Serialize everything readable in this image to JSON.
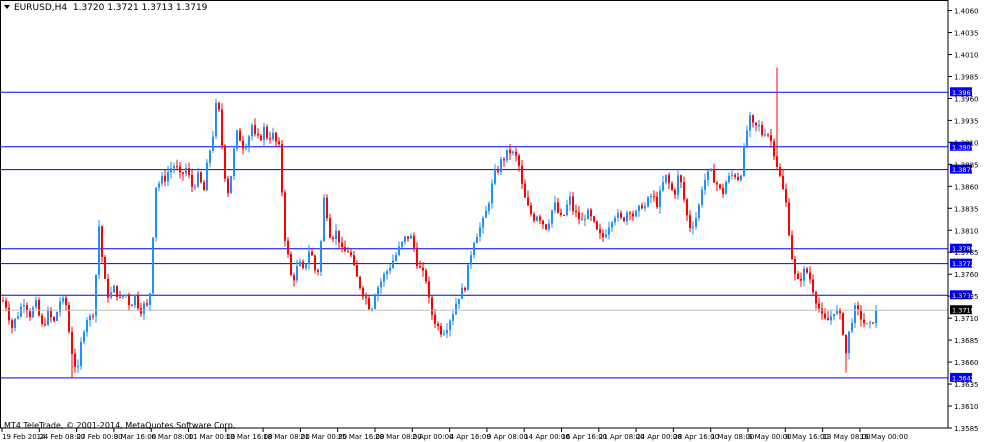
{
  "window": {
    "symbol_title": "EURUSD,H4",
    "ohlc": "1.3720 1.3721 1.3713 1.3719",
    "copyright": "MT4 TeleTrade, © 2001-2014, MetaQuotes Software Corp."
  },
  "colors": {
    "background": "#ffffff",
    "bull_candle": "#1e90ff",
    "bear_candle": "#ff0000",
    "level_line": "#0000ff",
    "level_label_bg": "#0000ff",
    "current_price_bg": "#000000",
    "axis_text": "#000000"
  },
  "chart_data": {
    "type": "candlestick",
    "symbol": "EURUSD",
    "timeframe": "H4",
    "y_axis": {
      "ticks": [
        "1.4060",
        "1.4035",
        "1.4010",
        "1.3985",
        "1.3960",
        "1.3935",
        "1.3910",
        "1.3885",
        "1.3860",
        "1.3835",
        "1.3810",
        "1.3785",
        "1.3760",
        "1.3735",
        "1.3710",
        "1.3685",
        "1.3660",
        "1.3635",
        "1.3610",
        "1.3585"
      ],
      "range": [
        1.3585,
        1.4072
      ]
    },
    "x_axis": {
      "ticks": [
        "19 Feb 2014",
        "24 Feb 08:00",
        "27 Feb 00:00",
        "3 Mar 16:00",
        "6 Mar 08:00",
        "11 Mar 00:00",
        "13 Mar 16:00",
        "18 Mar 08:00",
        "21 Mar 00:00",
        "25 Mar 16:00",
        "28 Mar 08:00",
        "2 Apr 00:00",
        "4 Apr 16:00",
        "9 Apr 08:00",
        "14 Apr 00:00",
        "16 Apr 16:00",
        "21 Apr 08:00",
        "24 Apr 00:00",
        "28 Apr 16:00",
        "1 May 08:00",
        "6 May 00:00",
        "8 May 16:00",
        "13 May 08:00",
        "16 May 00:00"
      ]
    },
    "horizontal_levels": [
      "1.3967",
      "1.3905",
      "1.3879",
      "1.3789",
      "1.3772",
      "1.3736",
      "1.3642"
    ],
    "current_price": "1.3719",
    "price_path": [
      [
        0,
        1.3735
      ],
      [
        6,
        1.3725
      ],
      [
        12,
        1.37
      ],
      [
        18,
        1.3715
      ],
      [
        24,
        1.373
      ],
      [
        30,
        1.3715
      ],
      [
        36,
        1.3725
      ],
      [
        42,
        1.37
      ],
      [
        48,
        1.3715
      ],
      [
        54,
        1.3705
      ],
      [
        60,
        1.373
      ],
      [
        66,
        1.3725
      ],
      [
        70,
        1.3685
      ],
      [
        74,
        1.366
      ],
      [
        78,
        1.365
      ],
      [
        81,
        1.368
      ],
      [
        84,
        1.37
      ],
      [
        88,
        1.3715
      ],
      [
        92,
        1.3705
      ],
      [
        96,
        1.376
      ],
      [
        99,
        1.3815
      ],
      [
        102,
        1.378
      ],
      [
        106,
        1.374
      ],
      [
        110,
        1.3735
      ],
      [
        115,
        1.3745
      ],
      [
        120,
        1.373
      ],
      [
        125,
        1.374
      ],
      [
        130,
        1.3725
      ],
      [
        135,
        1.3735
      ],
      [
        140,
        1.372
      ],
      [
        145,
        1.3725
      ],
      [
        149,
        1.372
      ],
      [
        152,
        1.378
      ],
      [
        155,
        1.386
      ],
      [
        160,
        1.3865
      ],
      [
        165,
        1.387
      ],
      [
        170,
        1.388
      ],
      [
        175,
        1.3885
      ],
      [
        180,
        1.387
      ],
      [
        186,
        1.388
      ],
      [
        192,
        1.386
      ],
      [
        198,
        1.387
      ],
      [
        204,
        1.3855
      ],
      [
        208,
        1.389
      ],
      [
        213,
        1.392
      ],
      [
        217,
        1.396
      ],
      [
        220,
        1.3935
      ],
      [
        224,
        1.388
      ],
      [
        228,
        1.3855
      ],
      [
        232,
        1.388
      ],
      [
        236,
        1.392
      ],
      [
        240,
        1.3915
      ],
      [
        244,
        1.3905
      ],
      [
        248,
        1.3915
      ],
      [
        252,
        1.393
      ],
      [
        256,
        1.391
      ],
      [
        260,
        1.3915
      ],
      [
        264,
        1.3925
      ],
      [
        268,
        1.3915
      ],
      [
        272,
        1.392
      ],
      [
        276,
        1.391
      ],
      [
        280,
        1.39
      ],
      [
        284,
        1.381
      ],
      [
        288,
        1.378
      ],
      [
        292,
        1.375
      ],
      [
        296,
        1.3765
      ],
      [
        300,
        1.377
      ],
      [
        304,
        1.376
      ],
      [
        308,
        1.379
      ],
      [
        312,
        1.378
      ],
      [
        316,
        1.376
      ],
      [
        320,
        1.377
      ],
      [
        323,
        1.385
      ],
      [
        327,
        1.383
      ],
      [
        331,
        1.38
      ],
      [
        335,
        1.381
      ],
      [
        339,
        1.38
      ],
      [
        343,
        1.378
      ],
      [
        347,
        1.379
      ],
      [
        351,
        1.378
      ],
      [
        355,
        1.376
      ],
      [
        359,
        1.375
      ],
      [
        363,
        1.374
      ],
      [
        367,
        1.373
      ],
      [
        371,
        1.372
      ],
      [
        375,
        1.374
      ],
      [
        380,
        1.375
      ],
      [
        385,
        1.376
      ],
      [
        390,
        1.377
      ],
      [
        395,
        1.378
      ],
      [
        400,
        1.379
      ],
      [
        405,
        1.38
      ],
      [
        410,
        1.3805
      ],
      [
        414,
        1.379
      ],
      [
        418,
        1.377
      ],
      [
        422,
        1.376
      ],
      [
        426,
        1.3755
      ],
      [
        430,
        1.372
      ],
      [
        434,
        1.371
      ],
      [
        438,
        1.37
      ],
      [
        442,
        1.3695
      ],
      [
        446,
        1.37
      ],
      [
        450,
        1.371
      ],
      [
        454,
        1.372
      ],
      [
        458,
        1.3735
      ],
      [
        462,
        1.374
      ],
      [
        466,
        1.375
      ],
      [
        470,
        1.378
      ],
      [
        474,
        1.38
      ],
      [
        478,
        1.381
      ],
      [
        482,
        1.3815
      ],
      [
        486,
        1.383
      ],
      [
        490,
        1.385
      ],
      [
        494,
        1.387
      ],
      [
        498,
        1.388
      ],
      [
        502,
        1.389
      ],
      [
        506,
        1.3895
      ],
      [
        510,
        1.39
      ],
      [
        514,
        1.3895
      ],
      [
        518,
        1.389
      ],
      [
        522,
        1.386
      ],
      [
        526,
        1.384
      ],
      [
        530,
        1.383
      ],
      [
        534,
        1.3825
      ],
      [
        538,
        1.383
      ],
      [
        542,
        1.382
      ],
      [
        546,
        1.3815
      ],
      [
        550,
        1.3825
      ],
      [
        554,
        1.384
      ],
      [
        558,
        1.383
      ],
      [
        562,
        1.382
      ],
      [
        566,
        1.3835
      ],
      [
        570,
        1.3845
      ],
      [
        574,
        1.383
      ],
      [
        578,
        1.3825
      ],
      [
        582,
        1.382
      ],
      [
        586,
        1.383
      ],
      [
        590,
        1.3825
      ],
      [
        594,
        1.3815
      ],
      [
        598,
        1.3805
      ],
      [
        602,
        1.38
      ],
      [
        606,
        1.381
      ],
      [
        610,
        1.382
      ],
      [
        614,
        1.383
      ],
      [
        618,
        1.3825
      ],
      [
        622,
        1.382
      ],
      [
        626,
        1.383
      ],
      [
        630,
        1.3835
      ],
      [
        634,
        1.3825
      ],
      [
        638,
        1.383
      ],
      [
        642,
        1.384
      ],
      [
        646,
        1.3835
      ],
      [
        650,
        1.385
      ],
      [
        654,
        1.3845
      ],
      [
        658,
        1.384
      ],
      [
        662,
        1.386
      ],
      [
        666,
        1.387
      ],
      [
        670,
        1.386
      ],
      [
        674,
        1.385
      ],
      [
        678,
        1.387
      ],
      [
        682,
        1.386
      ],
      [
        686,
        1.383
      ],
      [
        690,
        1.3815
      ],
      [
        694,
        1.382
      ],
      [
        698,
        1.383
      ],
      [
        702,
        1.386
      ],
      [
        706,
        1.387
      ],
      [
        710,
        1.3875
      ],
      [
        714,
        1.387
      ],
      [
        718,
        1.386
      ],
      [
        722,
        1.385
      ],
      [
        726,
        1.3865
      ],
      [
        730,
        1.387
      ],
      [
        734,
        1.3875
      ],
      [
        738,
        1.387
      ],
      [
        742,
        1.388
      ],
      [
        746,
        1.392
      ],
      [
        750,
        1.3935
      ],
      [
        754,
        1.3925
      ],
      [
        758,
        1.393
      ],
      [
        762,
        1.392
      ],
      [
        766,
        1.3925
      ],
      [
        770,
        1.3915
      ],
      [
        774,
        1.39
      ],
      [
        778,
        1.388
      ],
      [
        782,
        1.386
      ],
      [
        786,
        1.384
      ],
      [
        790,
        1.38
      ],
      [
        794,
        1.376
      ],
      [
        798,
        1.375
      ],
      [
        802,
        1.376
      ],
      [
        806,
        1.3765
      ],
      [
        810,
        1.3755
      ],
      [
        814,
        1.374
      ],
      [
        818,
        1.3725
      ],
      [
        822,
        1.371
      ],
      [
        826,
        1.3705
      ],
      [
        830,
        1.371
      ],
      [
        834,
        1.372
      ],
      [
        838,
        1.3715
      ],
      [
        842,
        1.3705
      ],
      [
        846,
        1.367
      ],
      [
        850,
        1.37
      ],
      [
        854,
        1.372
      ],
      [
        858,
        1.3715
      ],
      [
        862,
        1.371
      ],
      [
        866,
        1.37
      ],
      [
        870,
        1.37
      ],
      [
        874,
        1.3712
      ],
      [
        878,
        1.3719
      ]
    ],
    "spikes": [
      {
        "t": 776,
        "high": 1.3995
      },
      {
        "t": 73,
        "low": 1.3642
      },
      {
        "t": 845,
        "low": 1.3648
      }
    ]
  }
}
